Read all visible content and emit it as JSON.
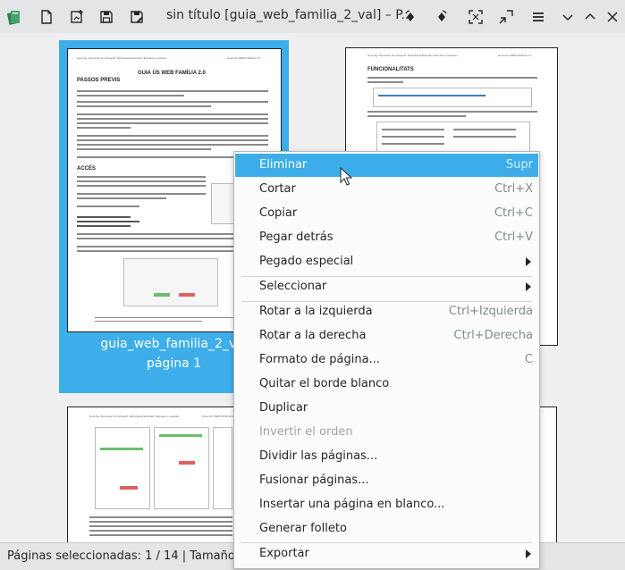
{
  "window": {
    "title": "sin título [guia_web_familia_2_val] – P..."
  },
  "toolbar": {
    "left_icons": [
      "app-icon",
      "new-icon",
      "import-icon",
      "save-icon",
      "save-as-icon"
    ],
    "right_icons": [
      "rotate-left-icon",
      "rotate-right-icon",
      "fullscreen-icon",
      "zoom-out-icon",
      "hamburger-menu-icon",
      "chevron-down-icon",
      "minimize-icon",
      "close-icon"
    ]
  },
  "pages": [
    {
      "label_line1": "guia_web_familia_2_val",
      "label_line2": "página 1",
      "selected": true,
      "header_left": "Guía Ág. Ifiernando Tormologefh. Eicilcclavell Educativ l'Escudos i Lautolas",
      "header_right": "Guía GO WEB FAMILIA 2.0",
      "title": "GUIA ÚS WEB FAMÍLIA 2.0",
      "section1": "PASSOS PREVIS",
      "section2": "ACCÉS"
    },
    {
      "header_left": "Guía Ág. Ifiernando Tormologefh. Eicilcclavell Educativ l'Escudos i Lautolas",
      "header_right": "Guía GO WEB FAMILIA 2.0",
      "section1": "FUNCIONALITATS"
    },
    {
      "header_left": "Guía Ág. Ifiernando Tormologefh. Eicilcclavell Educativ l'Escudos i Lautolas",
      "header_right": "Guía GO WEB FAMILIA 2.0"
    }
  ],
  "context_menu": {
    "items": [
      {
        "label": "Eliminar",
        "shortcut": "Supr",
        "highlighted": true
      },
      {
        "label": "Cortar",
        "shortcut": "Ctrl+X"
      },
      {
        "label": "Copiar",
        "shortcut": "Ctrl+C"
      },
      {
        "label": "Pegar detrás",
        "shortcut": "Ctrl+V"
      },
      {
        "label": "Pegado especial",
        "submenu": true
      },
      {
        "label": "Seleccionar",
        "submenu": true
      },
      {
        "label": "Rotar a la izquierda",
        "shortcut": "Ctrl+Izquierda"
      },
      {
        "label": "Rotar a la derecha",
        "shortcut": "Ctrl+Derecha"
      },
      {
        "label": "Formato de página...",
        "shortcut": "C"
      },
      {
        "label": "Quitar el borde blanco"
      },
      {
        "label": "Duplicar"
      },
      {
        "label": "Invertir el orden",
        "disabled": true
      },
      {
        "label": "Dividir las páginas..."
      },
      {
        "label": "Fusionar páginas..."
      },
      {
        "label": "Insertar una página en blanco..."
      },
      {
        "label": "Generar folleto"
      },
      {
        "label": "Exportar",
        "submenu": true
      }
    ]
  },
  "statusbar": {
    "text": "Páginas seleccionadas: 1 / 14 | Tamaño de"
  },
  "colors": {
    "selection": "#3daee9",
    "menu_highlight": "#3daee9",
    "background": "#efefef"
  }
}
